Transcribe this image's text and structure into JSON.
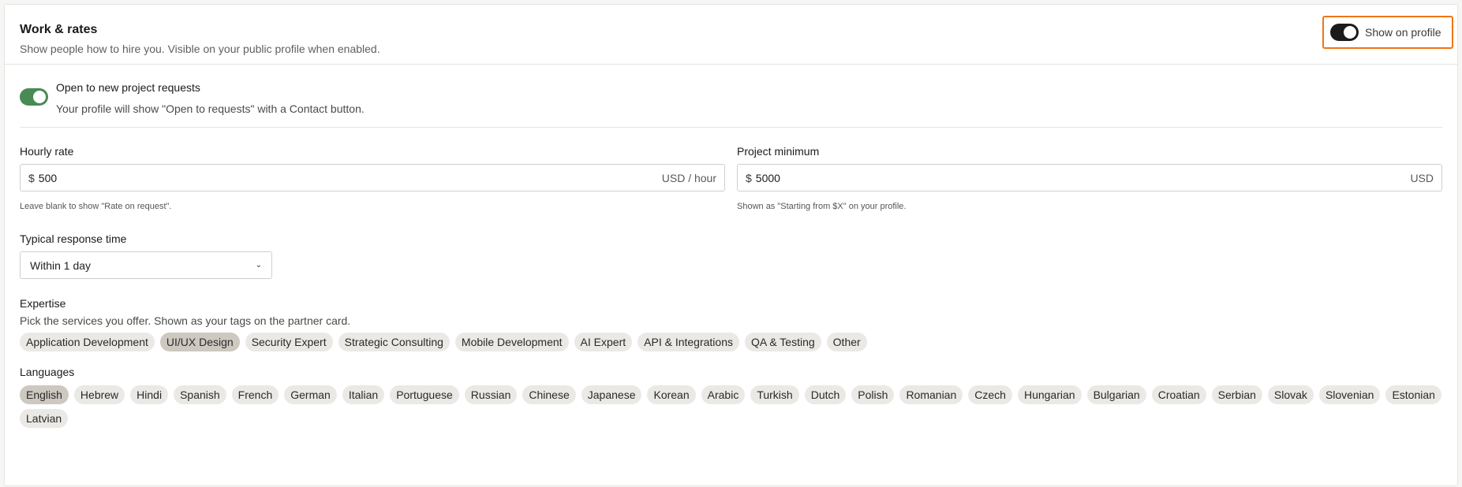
{
  "header": {
    "title": "Work & rates",
    "subtitle": "Show people how to hire you. Visible on your public profile when enabled.",
    "show_on_profile_label": "Show on profile",
    "show_on_profile_on": true
  },
  "open_requests": {
    "title": "Open to new project requests",
    "description": "Your profile will show \"Open to requests\" with a Contact button.",
    "enabled": true
  },
  "hourly_rate": {
    "label": "Hourly rate",
    "currency_symbol": "$",
    "value": "500",
    "unit": "USD / hour",
    "hint": "Leave blank to show \"Rate on request\"."
  },
  "project_minimum": {
    "label": "Project minimum",
    "currency_symbol": "$",
    "value": "5000",
    "unit": "USD",
    "hint": "Shown as \"Starting from $X\" on your profile."
  },
  "response_time": {
    "label": "Typical response time",
    "selected": "Within 1 day"
  },
  "expertise": {
    "label": "Expertise",
    "description": "Pick the services you offer. Shown as your tags on the partner card.",
    "items": [
      {
        "label": "Application Development",
        "selected": false
      },
      {
        "label": "UI/UX Design",
        "selected": true
      },
      {
        "label": "Security Expert",
        "selected": false
      },
      {
        "label": "Strategic Consulting",
        "selected": false
      },
      {
        "label": "Mobile Development",
        "selected": false
      },
      {
        "label": "AI Expert",
        "selected": false
      },
      {
        "label": "API & Integrations",
        "selected": false
      },
      {
        "label": "QA & Testing",
        "selected": false
      },
      {
        "label": "Other",
        "selected": false
      }
    ]
  },
  "languages": {
    "label": "Languages",
    "items": [
      {
        "label": "English",
        "selected": true
      },
      {
        "label": "Hebrew",
        "selected": false
      },
      {
        "label": "Hindi",
        "selected": false
      },
      {
        "label": "Spanish",
        "selected": false
      },
      {
        "label": "French",
        "selected": false
      },
      {
        "label": "German",
        "selected": false
      },
      {
        "label": "Italian",
        "selected": false
      },
      {
        "label": "Portuguese",
        "selected": false
      },
      {
        "label": "Russian",
        "selected": false
      },
      {
        "label": "Chinese",
        "selected": false
      },
      {
        "label": "Japanese",
        "selected": false
      },
      {
        "label": "Korean",
        "selected": false
      },
      {
        "label": "Arabic",
        "selected": false
      },
      {
        "label": "Turkish",
        "selected": false
      },
      {
        "label": "Dutch",
        "selected": false
      },
      {
        "label": "Polish",
        "selected": false
      },
      {
        "label": "Romanian",
        "selected": false
      },
      {
        "label": "Czech",
        "selected": false
      },
      {
        "label": "Hungarian",
        "selected": false
      },
      {
        "label": "Bulgarian",
        "selected": false
      },
      {
        "label": "Croatian",
        "selected": false
      },
      {
        "label": "Serbian",
        "selected": false
      },
      {
        "label": "Slovak",
        "selected": false
      },
      {
        "label": "Slovenian",
        "selected": false
      },
      {
        "label": "Estonian",
        "selected": false
      },
      {
        "label": "Latvian",
        "selected": false
      }
    ]
  },
  "colors": {
    "highlight_border": "#f07416",
    "toggle_dark": "#1b1b1b",
    "toggle_green": "#4a8a55",
    "chip_bg": "#ebe9e5",
    "chip_selected_bg": "#cdc8c0"
  }
}
